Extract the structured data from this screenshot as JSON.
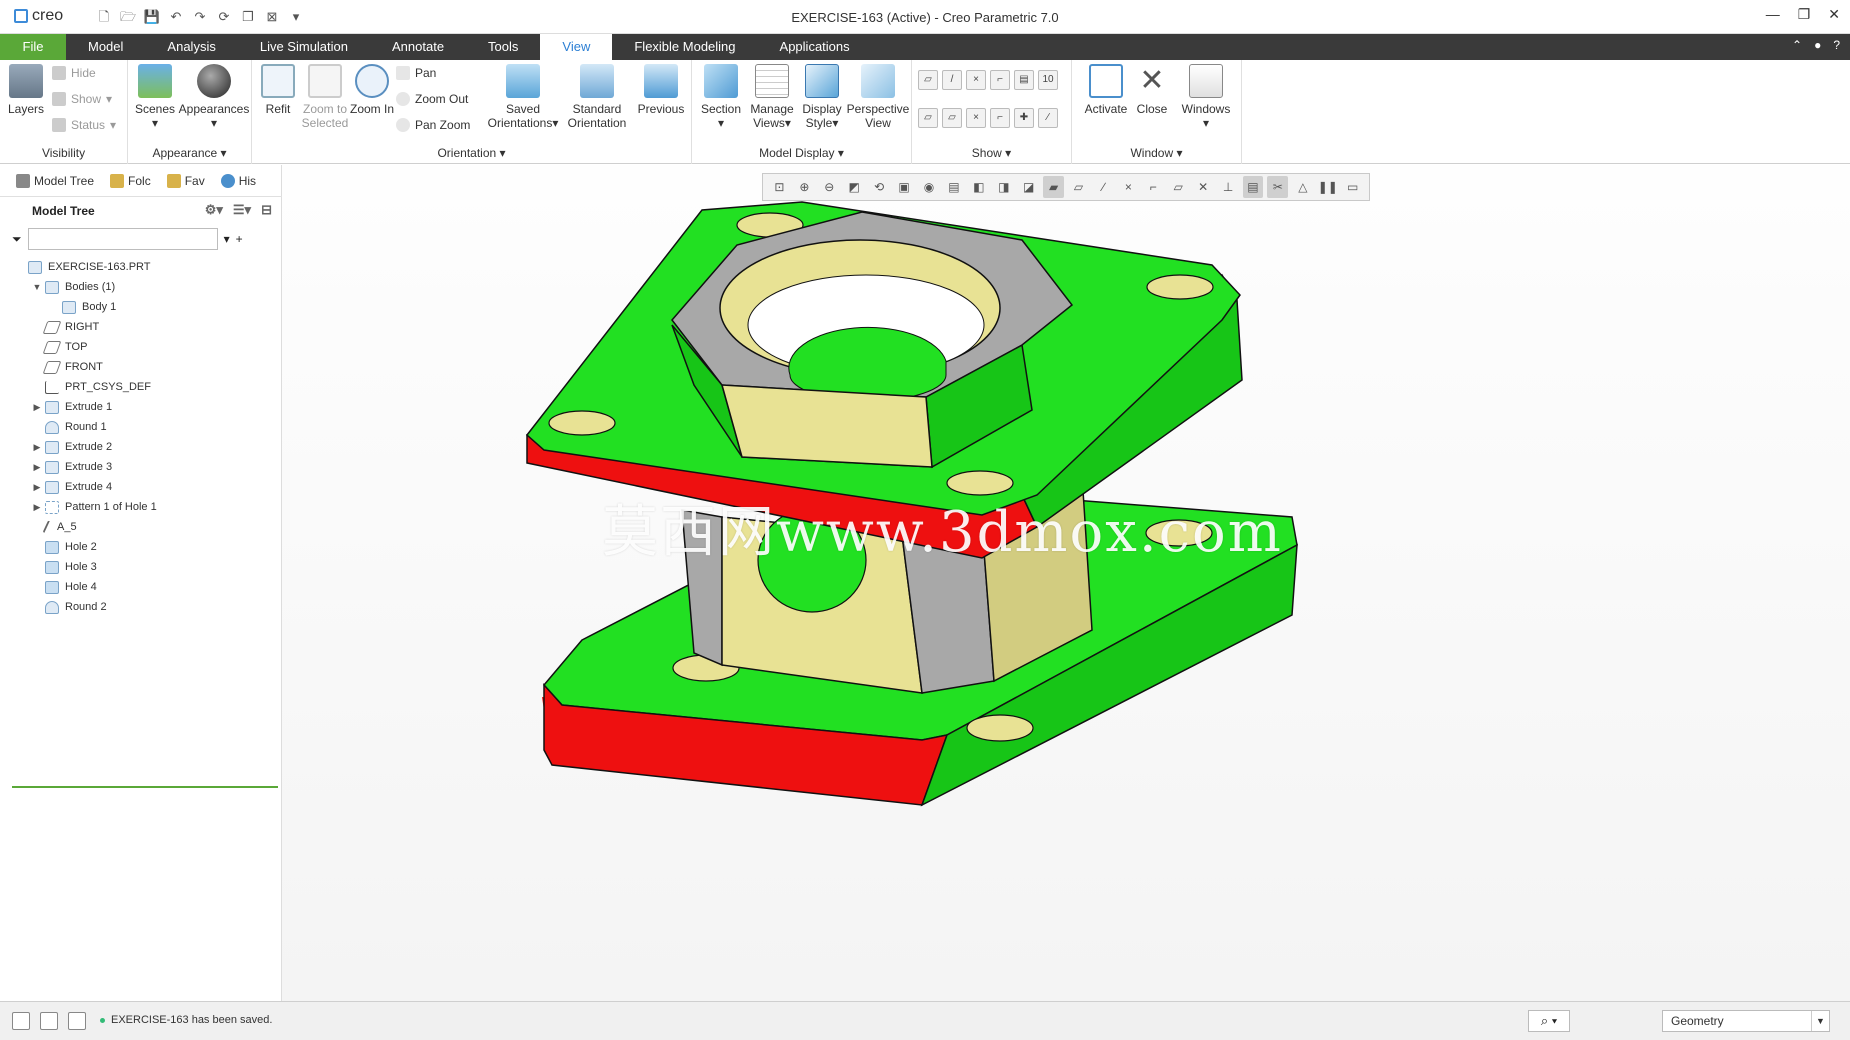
{
  "app": {
    "logo_text": "creo",
    "window_title": "EXERCISE-163 (Active) - Creo Parametric 7.0"
  },
  "tabs": [
    {
      "label": "File"
    },
    {
      "label": "Model"
    },
    {
      "label": "Analysis"
    },
    {
      "label": "Live Simulation"
    },
    {
      "label": "Annotate"
    },
    {
      "label": "Tools"
    },
    {
      "label": "View"
    },
    {
      "label": "Flexible Modeling"
    },
    {
      "label": "Applications"
    }
  ],
  "ribbon": {
    "visibility": {
      "label": "Visibility",
      "layers": "Layers",
      "hide": "Hide",
      "show": "Show",
      "status": "Status"
    },
    "appearance": {
      "label": "Appearance",
      "scenes": "Scenes",
      "appearances": "Appearances"
    },
    "orientation": {
      "label": "Orientation",
      "refit": "Refit",
      "zoom_to_selected": "Zoom to Selected",
      "zoom_in": "Zoom In",
      "pan": "Pan",
      "zoom_out": "Zoom Out",
      "pan_zoom": "Pan Zoom",
      "saved_orientations": "Saved Orientations",
      "standard_orientation": "Standard Orientation",
      "previous": "Previous"
    },
    "model_display": {
      "label": "Model Display",
      "section": "Section",
      "manage_views": "Manage Views",
      "display_style": "Display Style",
      "perspective_view": "Perspective View"
    },
    "show": {
      "label": "Show"
    },
    "window": {
      "label": "Window",
      "activate": "Activate",
      "close": "Close",
      "windows": "Windows"
    }
  },
  "left_panel": {
    "tabs": [
      {
        "label": "Model Tree"
      },
      {
        "label": "Folc"
      },
      {
        "label": "Fav"
      },
      {
        "label": "His"
      }
    ],
    "title": "Model Tree",
    "filter_value": "",
    "tree": [
      {
        "label": "EXERCISE-163.PRT",
        "level": 0,
        "expand": "",
        "icon": "part-icon"
      },
      {
        "label": "Bodies (1)",
        "level": 1,
        "expand": "▼",
        "icon": "bodies-icon"
      },
      {
        "label": "Body 1",
        "level": 2,
        "expand": "",
        "icon": "body-icon"
      },
      {
        "label": "RIGHT",
        "level": 1,
        "expand": "",
        "icon": "datum-plane-icon"
      },
      {
        "label": "TOP",
        "level": 1,
        "expand": "",
        "icon": "datum-plane-icon"
      },
      {
        "label": "FRONT",
        "level": 1,
        "expand": "",
        "icon": "datum-plane-icon"
      },
      {
        "label": "PRT_CSYS_DEF",
        "level": 1,
        "expand": "",
        "icon": "csys-icon"
      },
      {
        "label": "Extrude 1",
        "level": 1,
        "expand": "▶",
        "icon": "extrude-icon"
      },
      {
        "label": "Round 1",
        "level": 1,
        "expand": "",
        "icon": "round-icon"
      },
      {
        "label": "Extrude 2",
        "level": 1,
        "expand": "▶",
        "icon": "extrude-icon"
      },
      {
        "label": "Extrude 3",
        "level": 1,
        "expand": "▶",
        "icon": "extrude-icon"
      },
      {
        "label": "Extrude 4",
        "level": 1,
        "expand": "▶",
        "icon": "extrude-icon"
      },
      {
        "label": "Pattern 1 of Hole 1",
        "level": 1,
        "expand": "▶",
        "icon": "pattern-icon"
      },
      {
        "label": "A_5",
        "level": 1,
        "expand": "",
        "icon": "axis-icon"
      },
      {
        "label": "Hole 2",
        "level": 1,
        "expand": "",
        "icon": "hole-icon"
      },
      {
        "label": "Hole 3",
        "level": 1,
        "expand": "",
        "icon": "hole-icon"
      },
      {
        "label": "Hole 4",
        "level": 1,
        "expand": "",
        "icon": "hole-icon"
      },
      {
        "label": "Round 2",
        "level": 1,
        "expand": "",
        "icon": "round-icon"
      }
    ]
  },
  "graphics": {
    "watermark": "莫西网www.3dmox.com"
  },
  "status": {
    "message": "EXERCISE-163 has been saved.",
    "selection_filter": "Geometry"
  },
  "colors": {
    "accent": "#2c7fd4",
    "file_tab": "#5aa838",
    "tab_bar": "#3a3a3a",
    "face_green": "#22e022",
    "face_red": "#ee1010",
    "face_yellow": "#e8e294",
    "face_gray": "#a8a8a8"
  }
}
